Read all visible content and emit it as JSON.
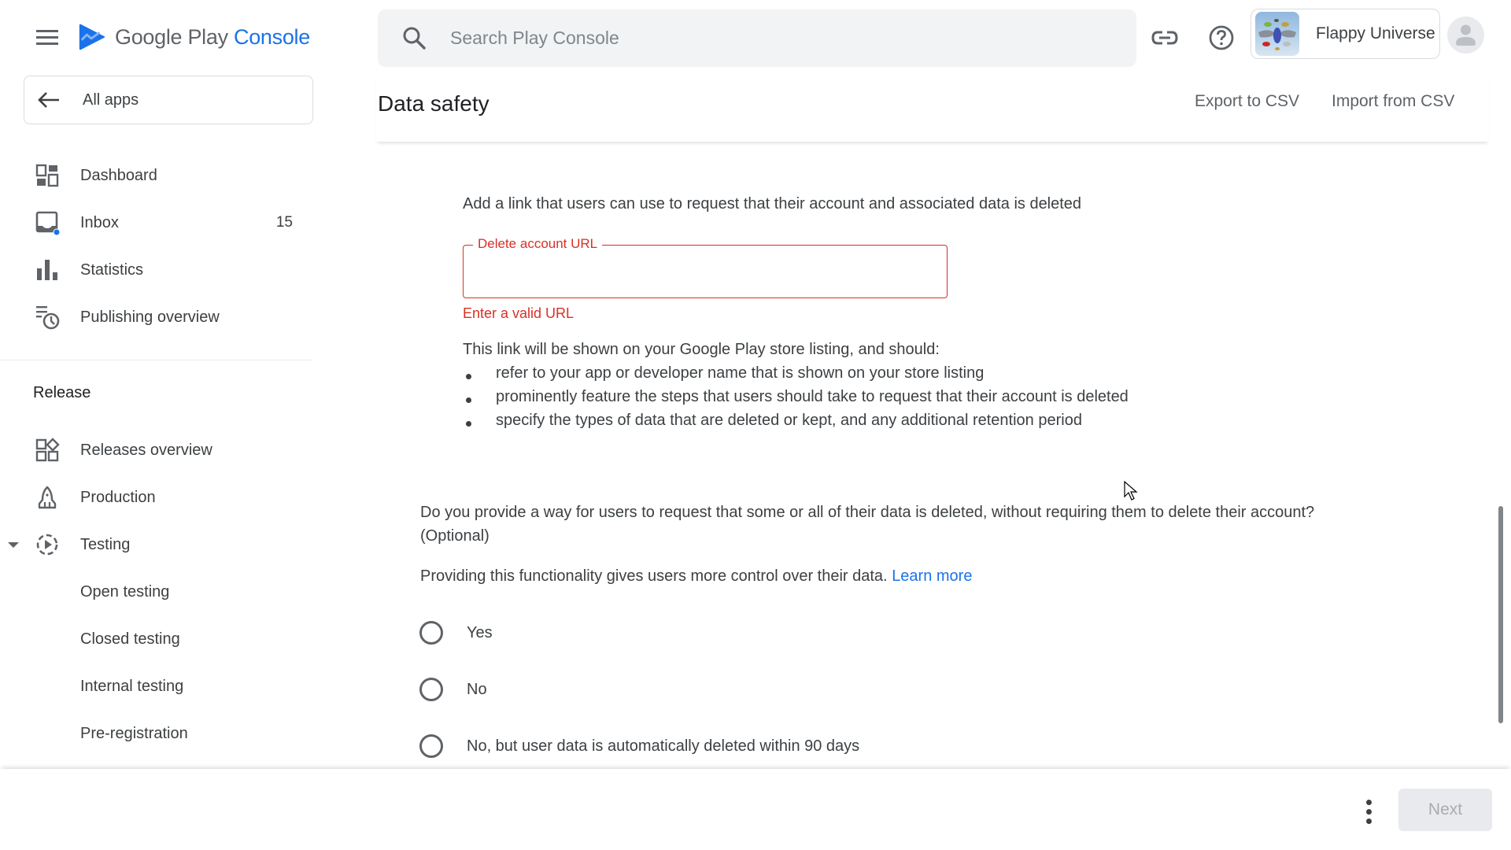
{
  "app": {
    "logo_text_primary": "Google Play",
    "logo_text_secondary": "Console",
    "brand_color": "#1a73e8"
  },
  "sidebar": {
    "all_apps_label": "All apps",
    "items": [
      {
        "label": "Dashboard",
        "icon": "dashboard-icon"
      },
      {
        "label": "Inbox",
        "icon": "inbox-icon",
        "count": "15",
        "has_unread_dot": true
      },
      {
        "label": "Statistics",
        "icon": "bar-chart-icon"
      },
      {
        "label": "Publishing overview",
        "icon": "publishing-overview-icon"
      }
    ],
    "section_header": "Release",
    "release_items": [
      {
        "label": "Releases overview",
        "icon": "releases-overview-icon"
      },
      {
        "label": "Production",
        "icon": "rocket-icon"
      },
      {
        "label": "Testing",
        "icon": "testing-icon",
        "expanded": true
      }
    ],
    "testing_subitems": [
      {
        "label": "Open testing"
      },
      {
        "label": "Closed testing"
      },
      {
        "label": "Internal testing"
      },
      {
        "label": "Pre-registration"
      }
    ]
  },
  "topbar": {
    "search_placeholder": "Search Play Console",
    "search_value": "",
    "app_name": "Flappy Universe"
  },
  "page": {
    "title": "Data safety",
    "export_label": "Export to CSV",
    "import_label": "Import from CSV"
  },
  "content": {
    "delete_link_intro": "Add a link that users can use to request that their account and associated data is deleted",
    "url_field": {
      "label": "Delete account URL",
      "value": "",
      "error": "Enter a valid URL",
      "error_color": "#d93025"
    },
    "guidance_intro": "This link will be shown on your Google Play store listing, and should:",
    "guidance_bullets": [
      "refer to your app or developer name that is shown on your store listing",
      "prominently feature the steps that users should take to request that their account is deleted",
      "specify the types of data that are deleted or kept, and any additional retention period"
    ],
    "question_line1": "Do you provide a way for users to request that some or all of their data is deleted, without requiring them to delete their account?",
    "question_line2": "(Optional)",
    "question_help": "Providing this functionality gives users more control over their data.",
    "learn_more": "Learn more",
    "options": [
      {
        "label": "Yes",
        "selected": false
      },
      {
        "label": "No",
        "selected": false
      },
      {
        "label": "No, but user data is automatically deleted within 90 days",
        "selected": false
      }
    ]
  },
  "footer": {
    "next_label": "Next",
    "next_enabled": false
  }
}
